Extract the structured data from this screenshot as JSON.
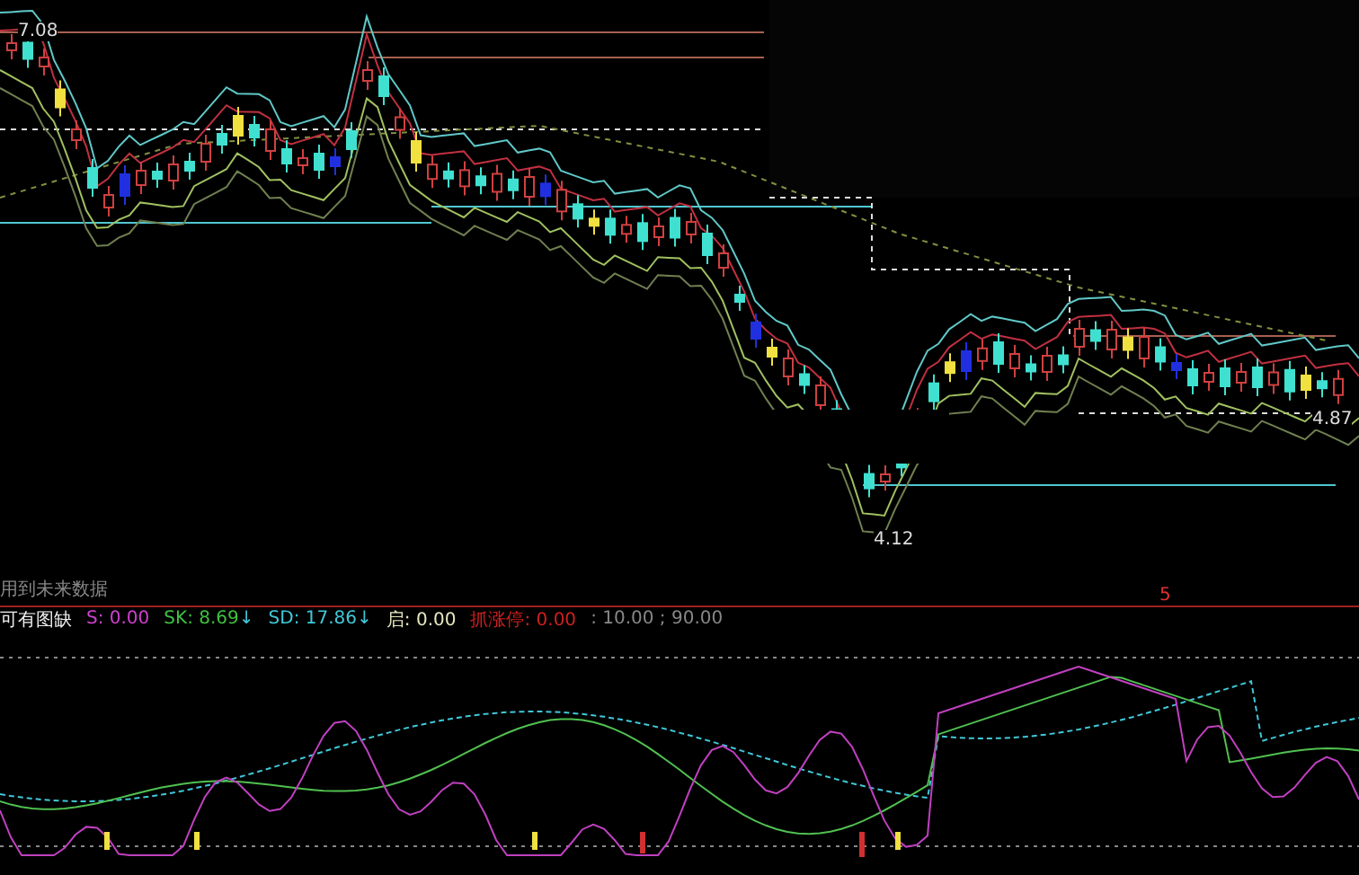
{
  "main_chart": {
    "price_labels": [
      {
        "text": "7.08",
        "kind": "high"
      },
      {
        "text": "4.12",
        "kind": "low"
      },
      {
        "text": "4.87",
        "kind": "last"
      }
    ],
    "note": "用到未来数据",
    "signal_mark": "5"
  },
  "indicator": {
    "title": "可有图缺",
    "legend": [
      {
        "label": "S:",
        "value": "0.00",
        "color": "#d040d0"
      },
      {
        "label": "SK:",
        "value": "8.69",
        "color": "#40c040",
        "arrow": "↓"
      },
      {
        "label": "SD:",
        "value": "17.86",
        "color": "#40c8d8",
        "arrow": "↓"
      },
      {
        "label": "启:",
        "value": "0.00",
        "color": "#e8e8c0"
      },
      {
        "label": "抓涨停:",
        "value": "0.00",
        "color": "#d02020"
      }
    ],
    "levels": ": 10.00 ; 90.00"
  }
}
